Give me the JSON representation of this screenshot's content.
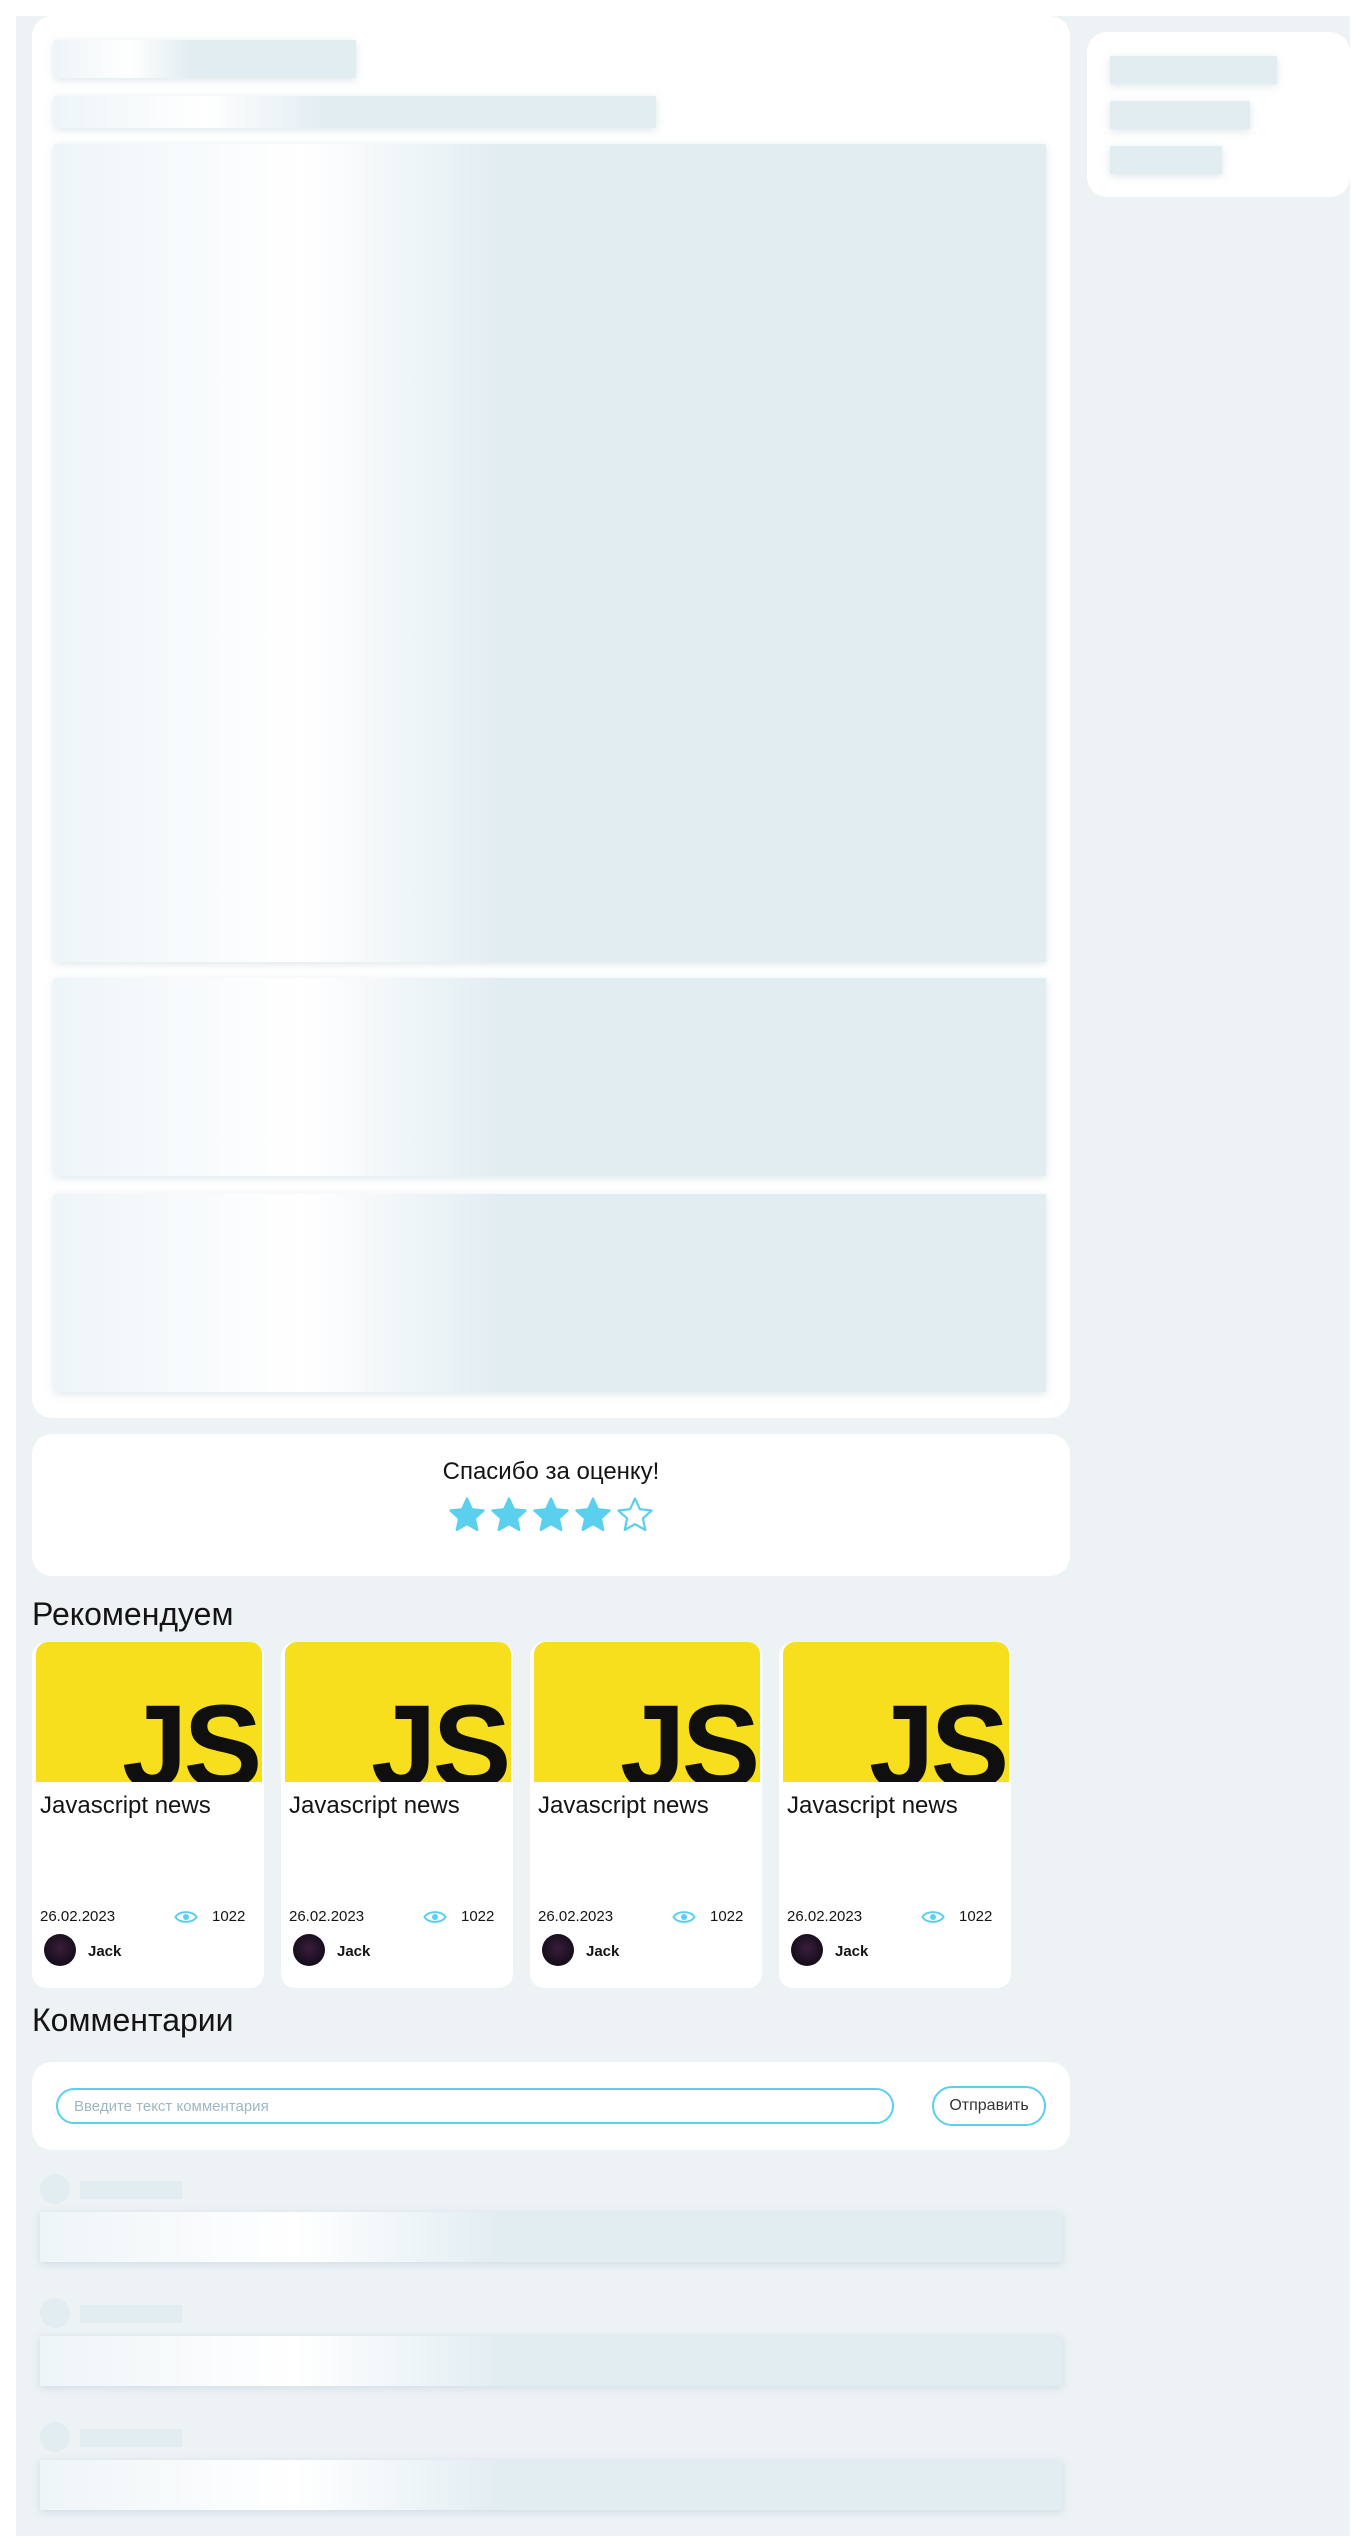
{
  "colors": {
    "accent": "#5ad0ee",
    "page_background": "#edf2f5",
    "card_background": "#ffffff",
    "skeleton": "#e2edf2",
    "js_yellow": "#f7df1e"
  },
  "rating": {
    "title": "Спасибо за оценку!",
    "value": 4,
    "max": 5
  },
  "recommendations": {
    "title": "Рекомендуем",
    "items": [
      {
        "logo_text": "JS",
        "title": "Javascript news",
        "date": "26.02.2023",
        "views": "1022",
        "author": "Jack"
      },
      {
        "logo_text": "JS",
        "title": "Javascript news",
        "date": "26.02.2023",
        "views": "1022",
        "author": "Jack"
      },
      {
        "logo_text": "JS",
        "title": "Javascript news",
        "date": "26.02.2023",
        "views": "1022",
        "author": "Jack"
      },
      {
        "logo_text": "JS",
        "title": "Javascript news",
        "date": "26.02.2023",
        "views": "1022",
        "author": "Jack"
      }
    ]
  },
  "comments": {
    "title": "Комментарии",
    "input_placeholder": "Введите текст комментария",
    "send_label": "Отправить"
  },
  "icons": {
    "star": "star-icon",
    "views": "eye-icon"
  }
}
